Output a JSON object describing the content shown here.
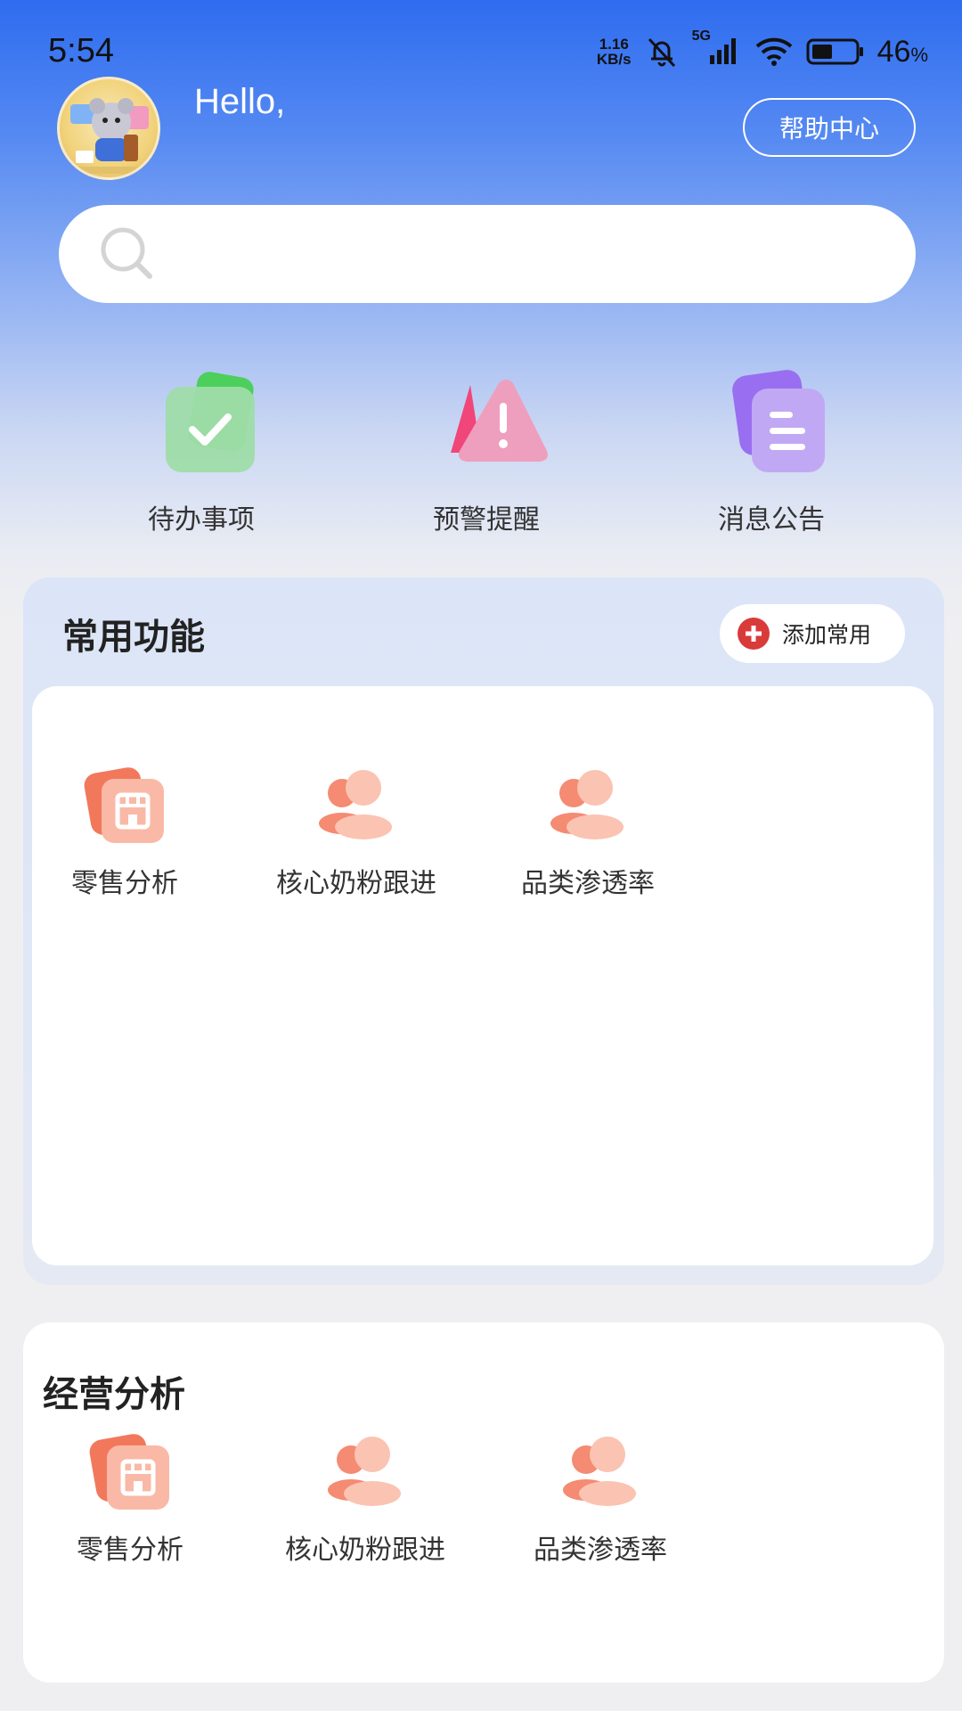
{
  "status_bar": {
    "time": "5:54",
    "net_speed_value": "1.16",
    "net_speed_unit": "KB/s",
    "network_type": "5G",
    "battery_value": "46",
    "battery_unit": "%",
    "icons": [
      "mute-bell-icon",
      "signal-icon",
      "wifi-icon",
      "battery-icon"
    ]
  },
  "header": {
    "greeting": "Hello,",
    "help_button": "帮助中心",
    "avatar_icon": "avatar-image"
  },
  "search": {
    "placeholder": "",
    "icon": "search-icon"
  },
  "quick_entries": [
    {
      "label": "待办事项",
      "icon": "todo-check-icon",
      "color": "#5cc97a"
    },
    {
      "label": "预警提醒",
      "icon": "warning-triangle-icon",
      "color": "#ef6a95"
    },
    {
      "label": "消息公告",
      "icon": "notice-document-icon",
      "color": "#a98af0"
    }
  ],
  "common_functions": {
    "title": "常用功能",
    "add_button": "添加常用",
    "items": [
      {
        "label": "零售分析",
        "icon": "store-icon"
      },
      {
        "label": "核心奶粉跟进",
        "icon": "users-icon"
      },
      {
        "label": "品类渗透率",
        "icon": "users-icon"
      }
    ]
  },
  "business_analysis": {
    "title": "经营分析",
    "items": [
      {
        "label": "零售分析",
        "icon": "store-icon"
      },
      {
        "label": "核心奶粉跟进",
        "icon": "users-icon"
      },
      {
        "label": "品类渗透率",
        "icon": "users-icon"
      }
    ]
  },
  "colors": {
    "header_blue": "#2e6cf0",
    "accent_red": "#d93a3a",
    "icon_salmon": "#f59a80"
  }
}
